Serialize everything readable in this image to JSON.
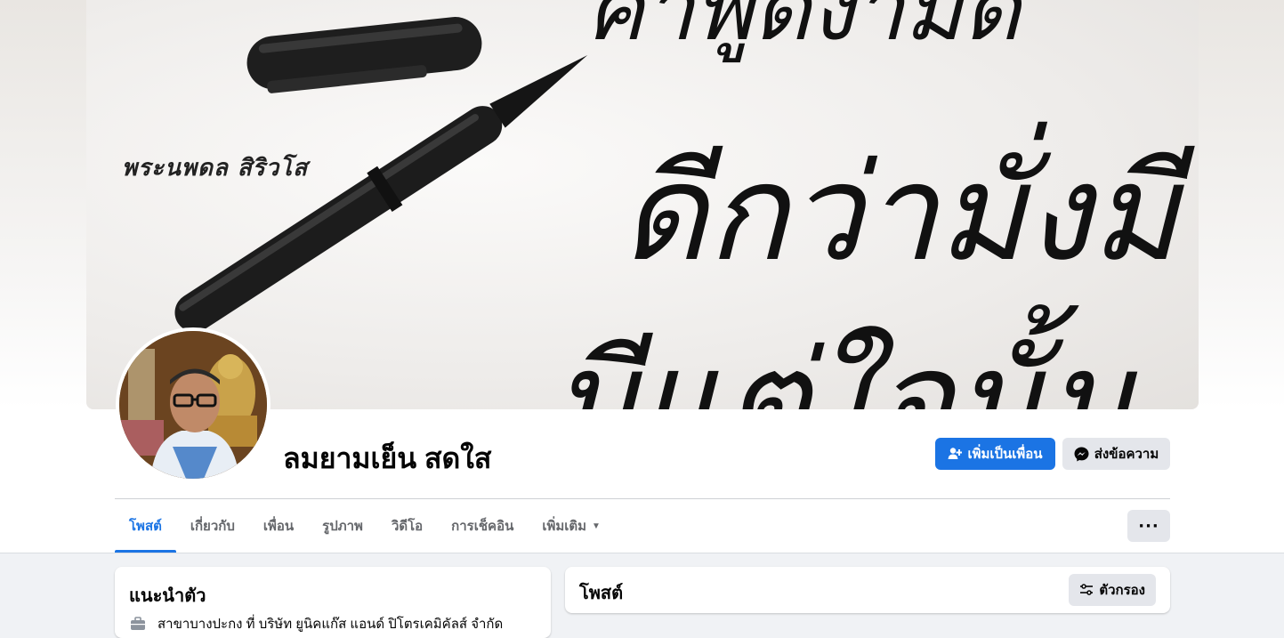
{
  "cover": {
    "caption": "พระนพดล สิริวโส",
    "text_line1": "คำพูดงามดี",
    "text_line2": "ดีกว่ามั่งมี",
    "text_line3": "มีแต่ใจนั้น"
  },
  "profile": {
    "name": "ลมยามเย็น สดใส"
  },
  "actions": {
    "add_friend_label": "เพิ่มเป็นเพื่อน",
    "message_label": "ส่งข้อความ",
    "more_label": "···"
  },
  "tabs": [
    {
      "label": "โพสต์",
      "active": true
    },
    {
      "label": "เกี่ยวกับ",
      "active": false
    },
    {
      "label": "เพื่อน",
      "active": false
    },
    {
      "label": "รูปภาพ",
      "active": false
    },
    {
      "label": "วิดีโอ",
      "active": false
    },
    {
      "label": "การเช็คอิน",
      "active": false
    },
    {
      "label": "เพิ่มเติม",
      "active": false
    }
  ],
  "intro": {
    "title": "แนะนำตัว",
    "work_text": "สาขาบางปะกง ที่ บริษัท ยูนิคแก๊ส แอนด์ ปิโตรเคมิคัลส์ จำกัด"
  },
  "posts": {
    "title": "โพสต์",
    "filter_label": "ตัวกรอง"
  },
  "colors": {
    "accent": "#1b74e4",
    "secondary_button": "#e4e6eb",
    "page_bg": "#f0f2f5"
  }
}
